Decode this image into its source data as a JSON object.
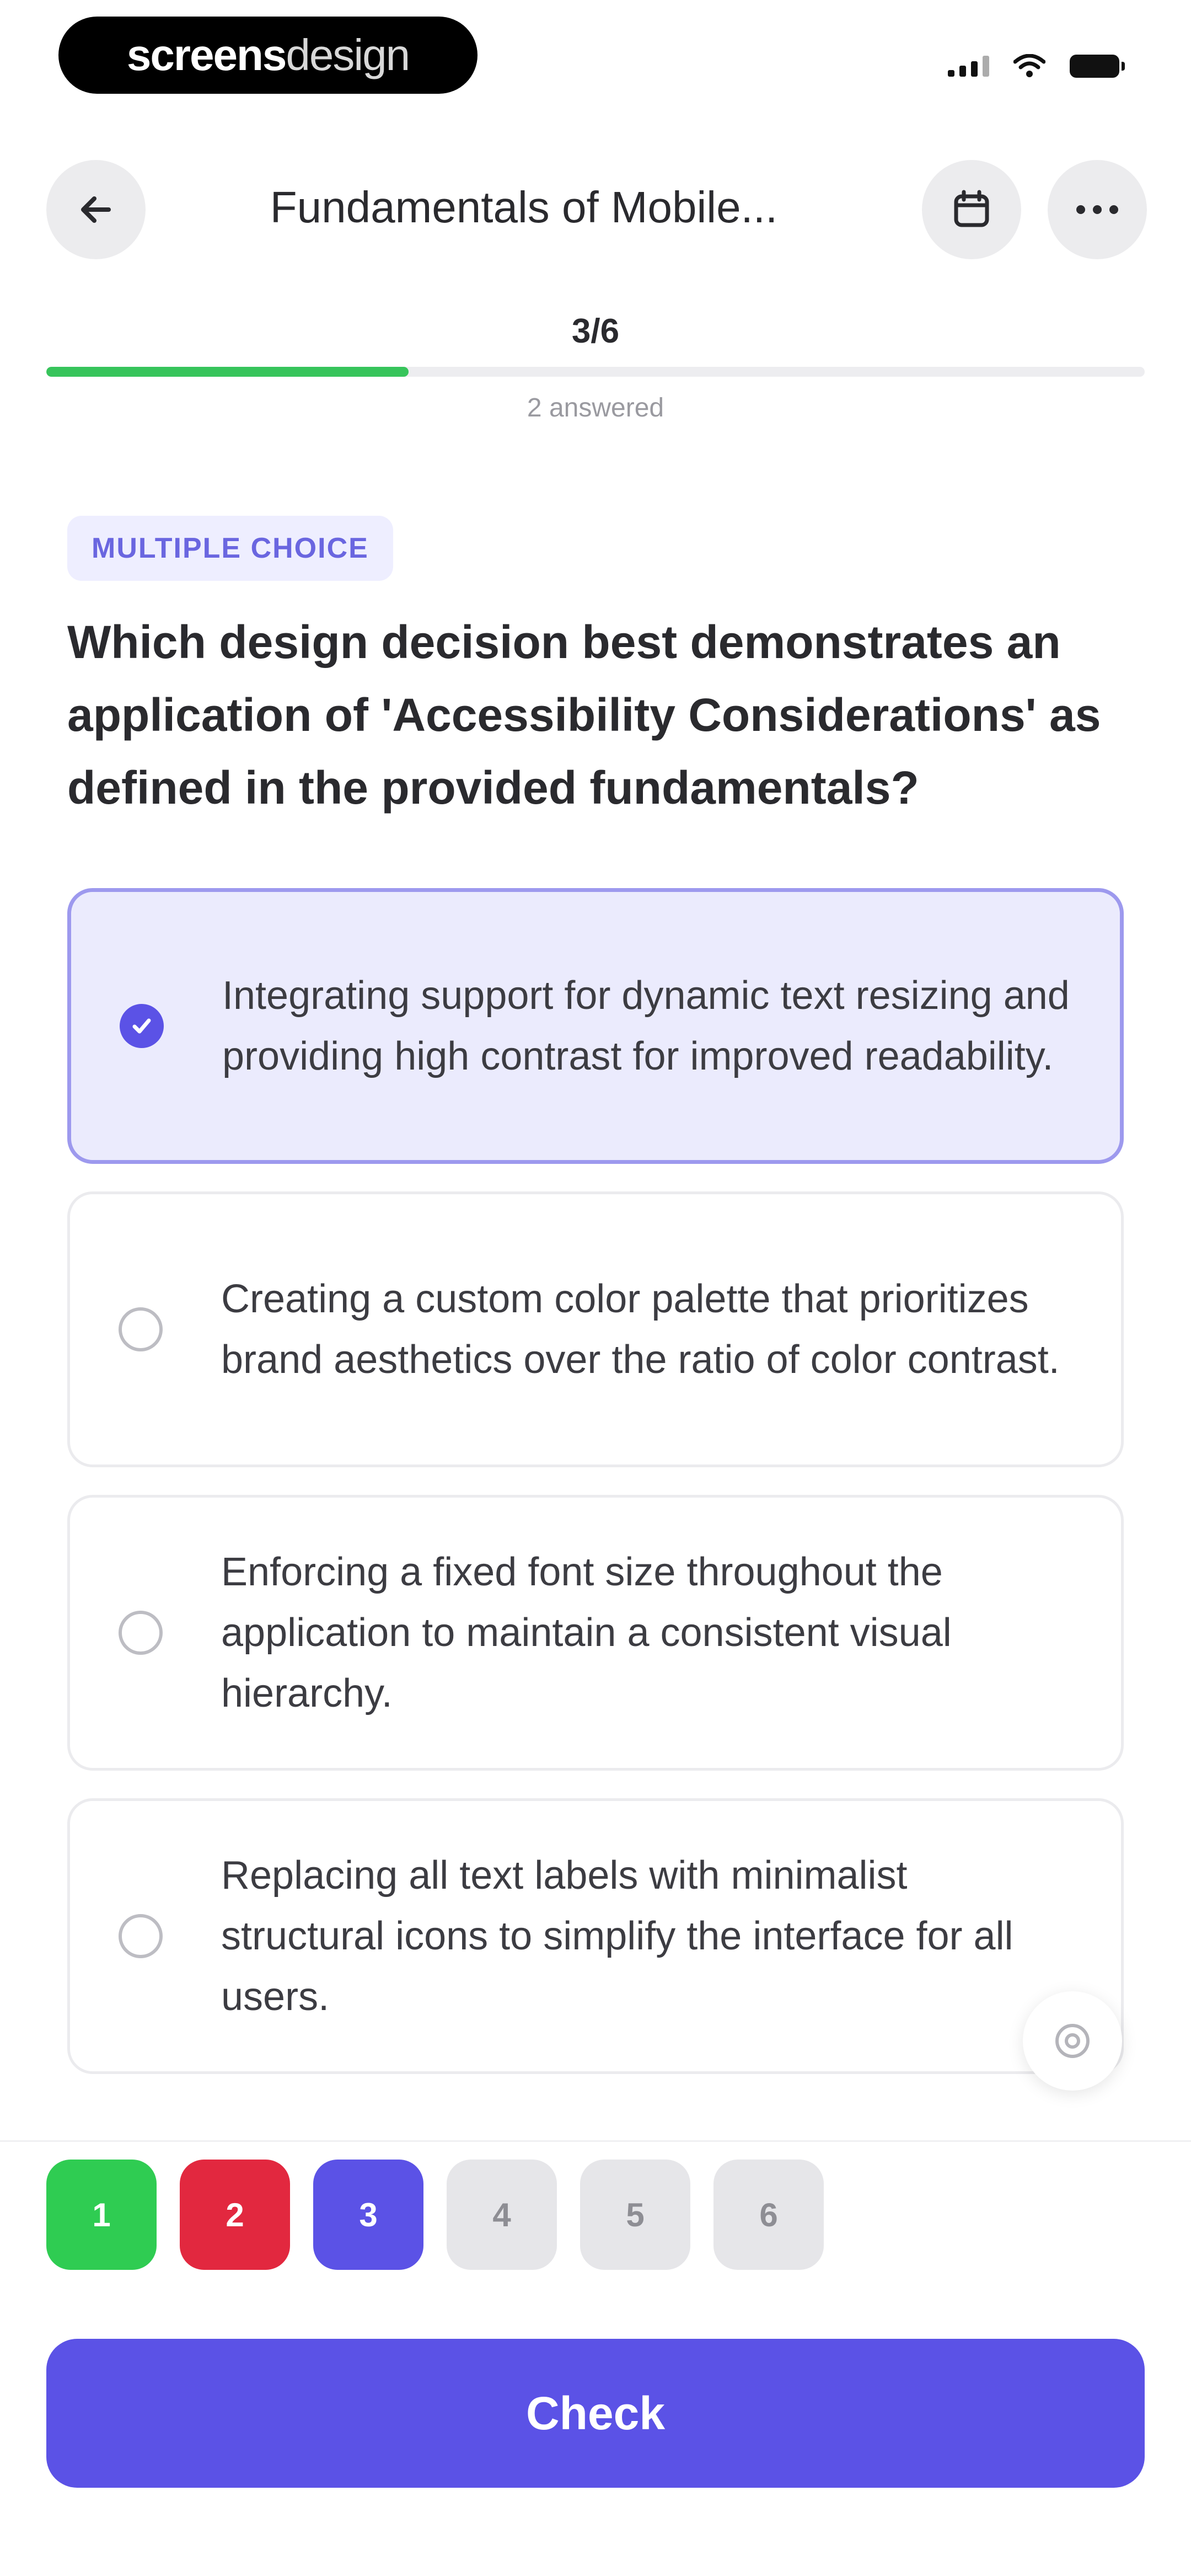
{
  "status_bar": {
    "brand_bold": "screens",
    "brand_light": "design",
    "icons": [
      "signal-icon",
      "wifi-icon",
      "battery-icon"
    ]
  },
  "header": {
    "title": "Fundamentals of Mobile...",
    "icons": [
      "back-arrow-icon",
      "calendar-icon",
      "more-icon"
    ]
  },
  "progress": {
    "counter": "3/6",
    "answered": "2 answered",
    "fraction": 0.33,
    "fill_color": "#37c45b"
  },
  "question": {
    "type_badge": "MULTIPLE CHOICE",
    "text": "Which design decision best demonstrates an application of 'Accessibility Considerations' as defined in the provided fundamentals?"
  },
  "options": [
    {
      "text": "Integrating support for dynamic text resizing and providing high contrast for improved readability.",
      "selected": true
    },
    {
      "text": "Creating a custom color palette that prioritizes brand aesthetics over the ratio of color contrast.",
      "selected": false
    },
    {
      "text": "Enforcing a fixed font size throughout the application to maintain a consistent visual hierarchy.",
      "selected": false
    },
    {
      "text": "Replacing all text labels with minimalist structural icons to simplify the interface for all users.",
      "selected": false
    }
  ],
  "navigator": [
    {
      "label": "1",
      "state": "correct"
    },
    {
      "label": "2",
      "state": "wrong"
    },
    {
      "label": "3",
      "state": "current"
    },
    {
      "label": "4",
      "state": "pending"
    },
    {
      "label": "5",
      "state": "pending"
    },
    {
      "label": "6",
      "state": "pending"
    }
  ],
  "colors": {
    "accent": "#5b52e6",
    "correct": "#2fcc52",
    "wrong": "#e2283f",
    "selected_bg": "#ebebfd"
  },
  "check_button": {
    "label": "Check"
  }
}
